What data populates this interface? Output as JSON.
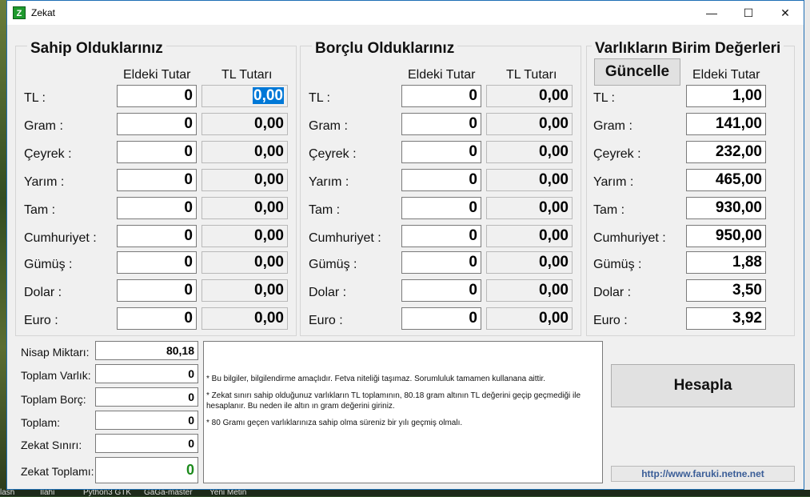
{
  "window": {
    "title": "Zekat",
    "icon_letter": "Z",
    "minimize": "—",
    "maximize": "☐",
    "close": "✕"
  },
  "owned": {
    "title": "Sahip Olduklarınız",
    "col_hand": "Eldeki Tutar",
    "col_tl": "TL Tutarı",
    "rows": [
      {
        "label": "TL :",
        "hand": "0",
        "tl": "0,00"
      },
      {
        "label": "Gram :",
        "hand": "0",
        "tl": "0,00"
      },
      {
        "label": "Çeyrek :",
        "hand": "0",
        "tl": "0,00"
      },
      {
        "label": "Yarım :",
        "hand": "0",
        "tl": "0,00"
      },
      {
        "label": "Tam :",
        "hand": "0",
        "tl": "0,00"
      },
      {
        "label": "Cumhuriyet :",
        "hand": "0",
        "tl": "0,00"
      },
      {
        "label": "Gümüş :",
        "hand": "0",
        "tl": "0,00"
      },
      {
        "label": "Dolar :",
        "hand": "0",
        "tl": "0,00"
      },
      {
        "label": "Euro :",
        "hand": "0",
        "tl": "0,00"
      }
    ]
  },
  "debts": {
    "title": "Borçlu Olduklarınız",
    "col_hand": "Eldeki Tutar",
    "col_tl": "TL Tutarı",
    "rows": [
      {
        "label": "TL :",
        "hand": "0",
        "tl": "0,00"
      },
      {
        "label": "Gram :",
        "hand": "0",
        "tl": "0,00"
      },
      {
        "label": "Çeyrek :",
        "hand": "0",
        "tl": "0,00"
      },
      {
        "label": "Yarım :",
        "hand": "0",
        "tl": "0,00"
      },
      {
        "label": "Tam :",
        "hand": "0",
        "tl": "0,00"
      },
      {
        "label": "Cumhuriyet :",
        "hand": "0",
        "tl": "0,00"
      },
      {
        "label": "Gümüş :",
        "hand": "0",
        "tl": "0,00"
      },
      {
        "label": "Dolar :",
        "hand": "0",
        "tl": "0,00"
      },
      {
        "label": "Euro :",
        "hand": "0",
        "tl": "0,00"
      }
    ]
  },
  "unit_values": {
    "title": "Varlıkların Birim Değerleri",
    "update_button": "Güncelle",
    "col_hand": "Eldeki Tutar",
    "rows": [
      {
        "label": "TL :",
        "value": "1,00"
      },
      {
        "label": "Gram :",
        "value": "141,00"
      },
      {
        "label": "Çeyrek :",
        "value": "232,00"
      },
      {
        "label": "Yarım :",
        "value": "465,00"
      },
      {
        "label": "Tam :",
        "value": "930,00"
      },
      {
        "label": "Cumhuriyet :",
        "value": "950,00"
      },
      {
        "label": "Gümüş :",
        "value": "1,88"
      },
      {
        "label": "Dolar :",
        "value": "3,50"
      },
      {
        "label": "Euro :",
        "value": "3,92"
      }
    ]
  },
  "summary": {
    "nisap_label": "Nisap Miktarı:",
    "nisap_value": "80,18",
    "assets_label": "Toplam Varlık:",
    "assets_value": "0",
    "debt_label": "Toplam Borç:",
    "debt_value": "0",
    "total_label": "Toplam:",
    "total_value": "0",
    "limit_label": "Zekat Sınırı:",
    "limit_value": "0",
    "zakat_label": "Zekat Toplamı:",
    "zakat_value": "0"
  },
  "notes": [
    "* Bu bilgiler, bilgilendirme amaçlıdır. Fetva niteliği taşımaz.  Sorumluluk tamamen kullanana aittir.",
    "* Zekat sınırı sahip olduğunuz varlıkların TL toplamının, 80.18 gram altının TL değerini geçip geçmediği ile hesaplanır.   Bu neden ile altın ın gram değerini giriniz.",
    "* 80 Gramı geçen varlıklarınıza sahip olma süreniz bir yılı geçmiş olmalı."
  ],
  "calc_button": "Hesapla",
  "link": "http://www.faruki.netne.net",
  "taskbar": [
    "lash",
    "İlahi",
    "Python3 GTK",
    "GaGa-master",
    "Yeni Metin"
  ]
}
